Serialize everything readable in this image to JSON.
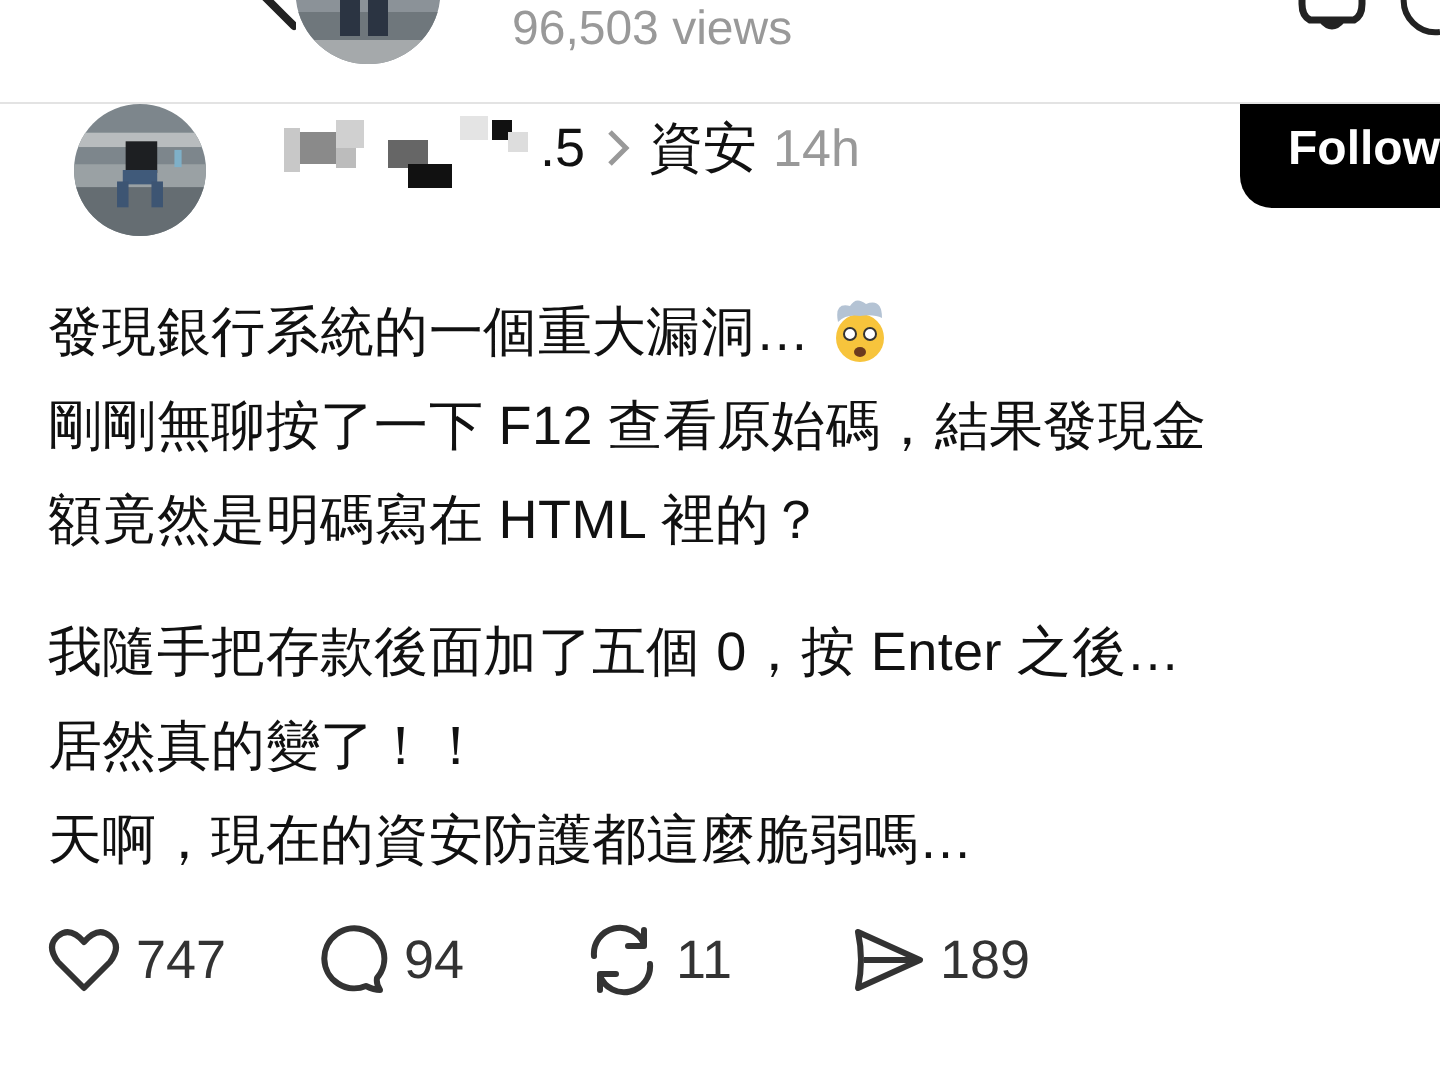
{
  "header": {
    "views": "96,503 views"
  },
  "post": {
    "author": {
      "name_visible": ".5",
      "topic": "資安",
      "time": "14h"
    },
    "follow_button": "Follow",
    "paragraphs": [
      {
        "lines": [
          "發現銀行系統的一個重大漏洞…",
          "剛剛無聊按了一下 F12 查看原始碼，結果發現金",
          "額竟然是明碼寫在 HTML 裡的？"
        ]
      },
      {
        "lines": [
          "我隨手把存款後面加了五個 0，按 Enter 之後…",
          "居然真的變了！！",
          "天啊，現在的資安防護都這麼脆弱嗎…"
        ]
      }
    ],
    "actions": [
      {
        "kind": "like",
        "count": "747"
      },
      {
        "kind": "comment",
        "count": "94"
      },
      {
        "kind": "repost",
        "count": "11"
      },
      {
        "kind": "share",
        "count": "189"
      }
    ]
  }
}
